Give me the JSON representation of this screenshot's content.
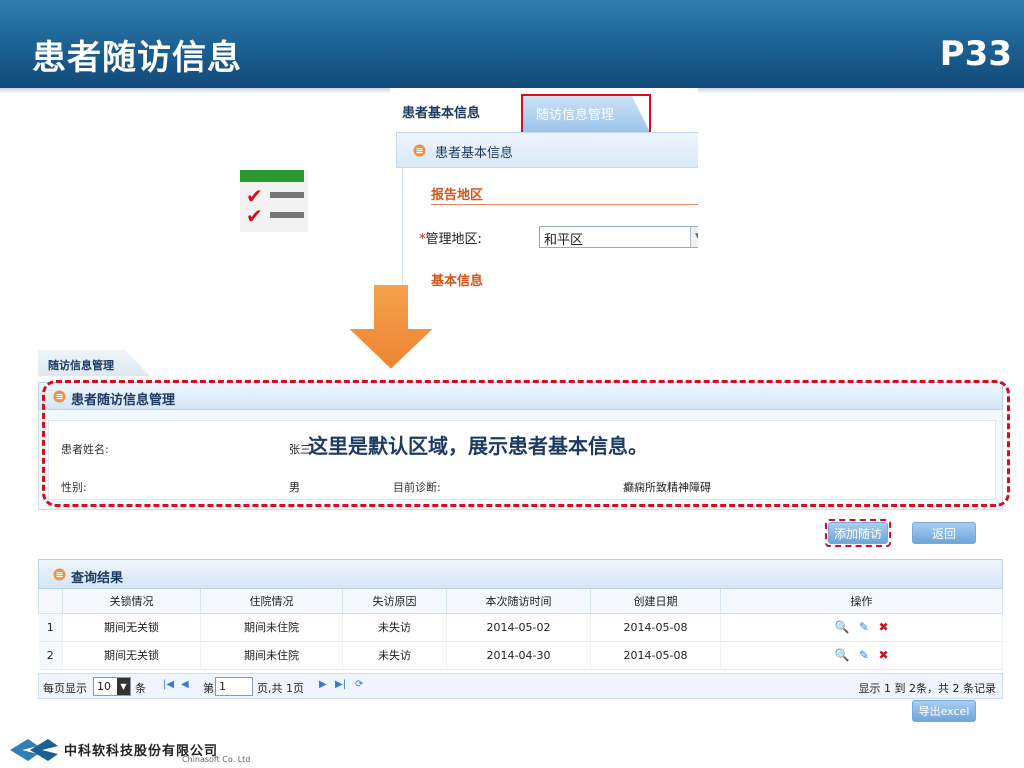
{
  "slide": {
    "title": "患者随访信息",
    "page": "P33"
  },
  "top_panel": {
    "tab_basic": "患者基本信息",
    "tab_follow": "随访信息管理",
    "section_title": "患者基本信息",
    "report_area": "报告地区",
    "admin_label": "管理地区:",
    "admin_value": "和平区",
    "basic_info": "基本信息"
  },
  "management": {
    "tab": "随访信息管理",
    "header": "患者随访信息管理",
    "name_label": "患者姓名:",
    "name_value": "张三",
    "gender_label": "性别:",
    "gender_value": "男",
    "diagnosis_label": "目前诊断:",
    "diagnosis_value": "癫痫所致精神障碍",
    "callout": "这里是默认区域，展示患者基本信息。",
    "add_button": "添加随访",
    "back_button": "返回"
  },
  "results": {
    "header": "查询结果",
    "columns": [
      "关锁情况",
      "住院情况",
      "失访原因",
      "本次随访时间",
      "创建日期",
      "操作"
    ],
    "rows": [
      {
        "no": "1",
        "lock": "期间无关锁",
        "hosp": "期间未住院",
        "lost": "未失访",
        "visit": "2014-05-02",
        "created": "2014-05-08"
      },
      {
        "no": "2",
        "lock": "期间无关锁",
        "hosp": "期间未住院",
        "lost": "未失访",
        "visit": "2014-04-30",
        "created": "2014-05-08"
      }
    ],
    "pager": {
      "per_page_label": "每页显示",
      "per_page": "10",
      "per_page_unit": "条",
      "page_prefix": "第",
      "page_value": "1",
      "page_suffix": "页,共 1页",
      "summary": "显示 1 到 2条，共 2 条记录"
    },
    "export_button": "导出excel"
  },
  "footer": {
    "company_cn": "中科软科技股份有限公司",
    "company_en": "Chinasoft Co. Ltd"
  },
  "colors": {
    "header_blue": "#1c5f92",
    "accent_orange": "#f0913c",
    "highlight_red": "#d01020",
    "section_orange": "#d7541c"
  }
}
